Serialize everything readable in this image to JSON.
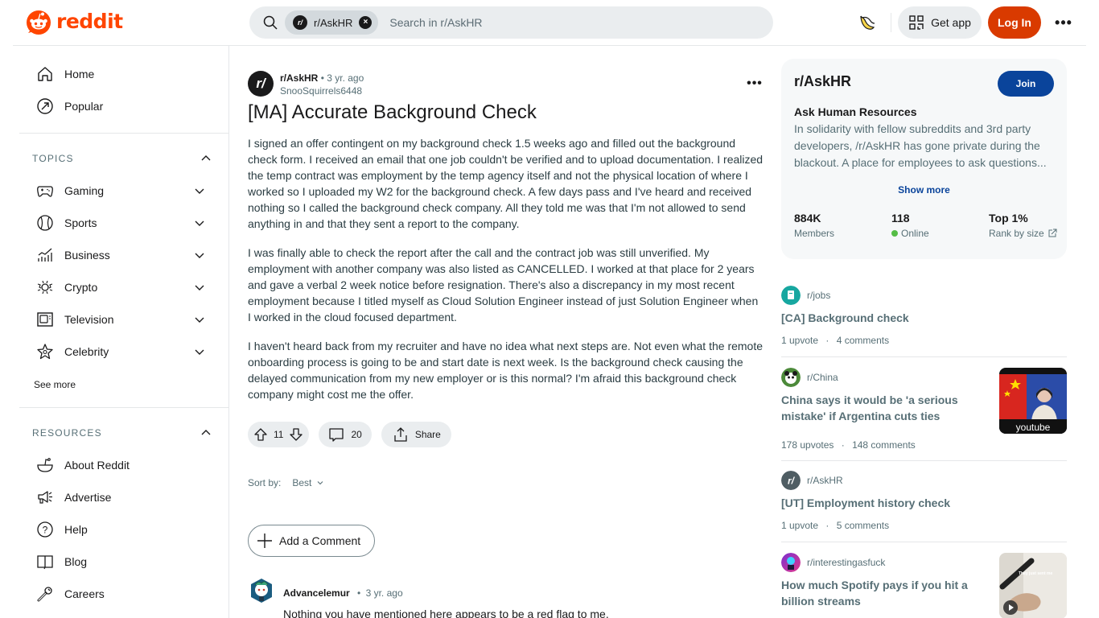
{
  "header": {
    "brand": "reddit",
    "search_chip": "r/AskHR",
    "search_placeholder": "Search in r/AskHR",
    "get_app": "Get app",
    "login": "Log In",
    "more": "•••"
  },
  "sidebar": {
    "primary": [
      {
        "label": "Home",
        "icon": "home-icon"
      },
      {
        "label": "Popular",
        "icon": "popular-icon"
      }
    ],
    "topics_header": "TOPICS",
    "topics": [
      {
        "label": "Gaming",
        "icon": "gaming-icon"
      },
      {
        "label": "Sports",
        "icon": "sports-icon"
      },
      {
        "label": "Business",
        "icon": "business-icon"
      },
      {
        "label": "Crypto",
        "icon": "crypto-icon"
      },
      {
        "label": "Television",
        "icon": "television-icon"
      },
      {
        "label": "Celebrity",
        "icon": "celebrity-icon"
      }
    ],
    "see_more": "See more",
    "resources_header": "RESOURCES",
    "resources": [
      {
        "label": "About Reddit",
        "icon": "about-reddit-icon"
      },
      {
        "label": "Advertise",
        "icon": "advertise-icon"
      },
      {
        "label": "Help",
        "icon": "help-icon"
      },
      {
        "label": "Blog",
        "icon": "blog-icon"
      },
      {
        "label": "Careers",
        "icon": "careers-icon"
      }
    ]
  },
  "post": {
    "subreddit": "r/AskHR",
    "subreddit_avatar": "r/",
    "separator": "•",
    "age": "3 yr. ago",
    "author": "SnooSquirrels6448",
    "title": "[MA] Accurate Background Check",
    "paragraphs": [
      "I signed an offer contingent on my background check 1.5 weeks ago and filled out the background check form. I received an email that one job couldn't be verified and to upload documentation. I realized the temp contract was employment by the temp agency itself and not the physical location of where I worked so I uploaded my W2 for the background check. A few days pass and I've heard and received nothing so I called the background check company. All they told me was that I'm not allowed to send anything in and that they sent a report to the company.",
      "I was finally able to check the report after the call and the contract job was still unverified. My employment with another company was also listed as CANCELLED. I worked at that place for 2 years and gave a verbal 2 week notice before resignation. There's also a discrepancy in my most recent employment because I titled myself as Cloud Solution Engineer instead of just Solution Engineer when I worked in the cloud focused department.",
      "I haven't heard back from my recruiter and have no idea what next steps are. Not even what the remote onboarding process is going to be and start date is next week. Is the background check causing the delayed communication from my new employer or is this normal? I'm afraid this background check company might cost me the offer."
    ],
    "votes": "11",
    "comments": "20",
    "share": "Share",
    "more": "•••"
  },
  "comments_section": {
    "sort_label": "Sort by:",
    "sort_value": "Best",
    "add_comment": "Add a Comment",
    "items": [
      {
        "author": "Advancelemur",
        "age": "3 yr. ago",
        "body": "Nothing you have mentioned here appears to be a red flag to me."
      }
    ]
  },
  "community": {
    "title": "r/AskHR",
    "join": "Join",
    "name": "Ask Human Resources",
    "description": "In solidarity with fellow subreddits and 3rd party developers, /r/AskHR has gone private during the blackout. A place for employees to ask questions...",
    "show_more": "Show more",
    "stats": [
      {
        "value": "884K",
        "label": "Members"
      },
      {
        "value": "118",
        "label": "Online"
      },
      {
        "value": "Top 1%",
        "label": "Rank by size"
      }
    ]
  },
  "related_posts": [
    {
      "subreddit": "r/jobs",
      "title": "[CA] Background check",
      "upvotes": "1 upvote",
      "comments": "4 comments",
      "thumbnail": null
    },
    {
      "subreddit": "r/China",
      "title": "China says it would be 'a serious mistake' if Argentina cuts ties",
      "upvotes": "178 upvotes",
      "comments": "148 comments",
      "thumbnail": "youtube"
    },
    {
      "subreddit": "r/AskHR",
      "title": "[UT] Employment history check",
      "upvotes": "1 upvote",
      "comments": "5 comments",
      "thumbnail": null
    },
    {
      "subreddit": "r/interestingasfuck",
      "title": "How much Spotify pays if you hit a billion streams",
      "upvotes": "",
      "comments": "",
      "thumbnail": "They just sent me"
    }
  ],
  "colors": {
    "brand": "#ff4500",
    "login": "#d93a00",
    "join": "#0a449b",
    "online": "#55bd46"
  }
}
